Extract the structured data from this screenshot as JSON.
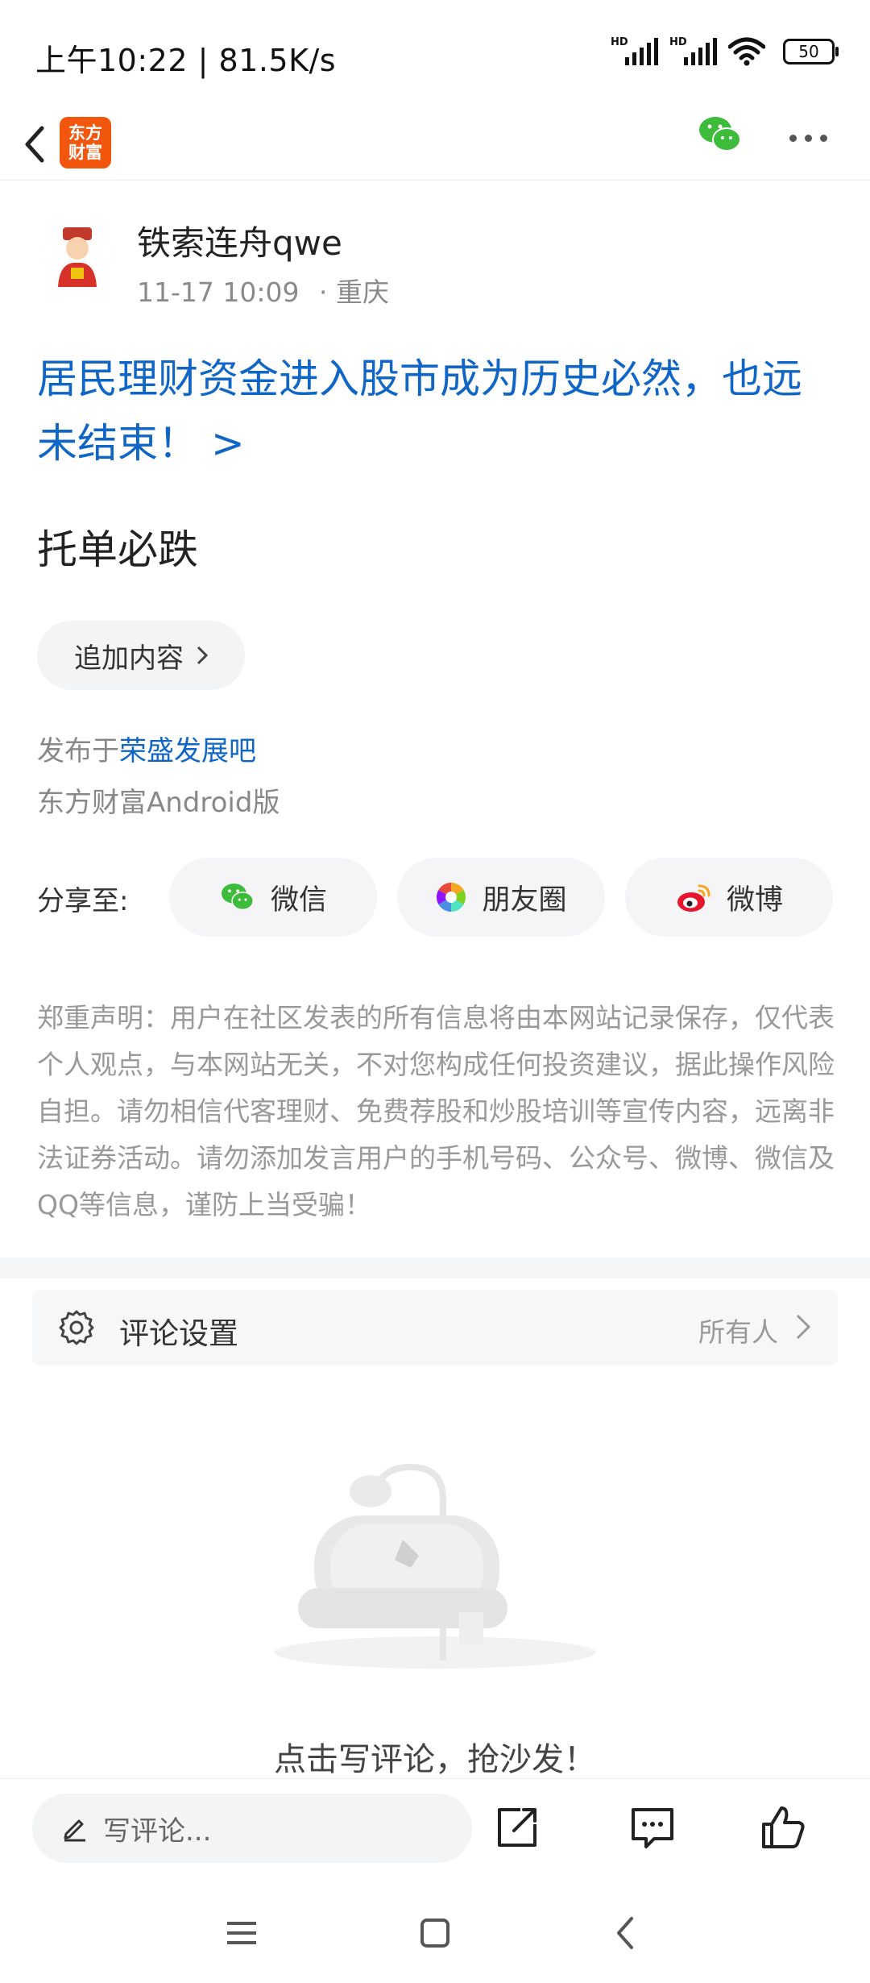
{
  "status_bar": {
    "time": "上午10:22 | 81.5K/s",
    "signal1_label": "HD",
    "signal2_label": "HD",
    "battery": "50"
  },
  "header": {
    "back_icon": "chevron-left-icon",
    "app_logo_line1": "东方",
    "app_logo_line2": "财富",
    "logo_color": "#f2560d",
    "wechat_icon": "wechat-icon",
    "more_icon": "more-icon"
  },
  "author": {
    "name": "铁索连舟qwe",
    "time": "11-17 10:09",
    "location": "· 重庆"
  },
  "post": {
    "title": "居民理财资金进入股市成为历史必然，也远未结束！ >",
    "body": "托单必跌",
    "append_label": "追加内容",
    "published_prefix": "发布于",
    "forum": "荣盛发展吧",
    "client": "东方财富Android版"
  },
  "share": {
    "label": "分享至:",
    "items": [
      {
        "label": "微信",
        "icon": "wechat-icon"
      },
      {
        "label": "朋友圈",
        "icon": "moments-icon"
      },
      {
        "label": "微博",
        "icon": "weibo-icon"
      }
    ]
  },
  "disclaimer": "郑重声明：用户在社区发表的所有信息将由本网站记录保存，仅代表个人观点，与本网站无关，不对您构成任何投资建议，据此操作风险自担。请勿相信代客理财、免费荐股和炒股培训等宣传内容，远离非法证券活动。请勿添加发言用户的手机号码、公众号、微博、微信及QQ等信息，谨防上当受骗！",
  "comment_settings": {
    "label": "评论设置",
    "value": "所有人"
  },
  "empty_state": {
    "text": "点击写评论，抢沙发！"
  },
  "bottom_bar": {
    "write_placeholder": "写评论...",
    "share_icon": "share-icon",
    "comment_icon": "comment-icon",
    "like_icon": "thumbs-up-icon"
  },
  "colors": {
    "link_blue": "#1066c6",
    "wechat_green": "#3dbb3a",
    "weibo_red": "#e6162d"
  }
}
